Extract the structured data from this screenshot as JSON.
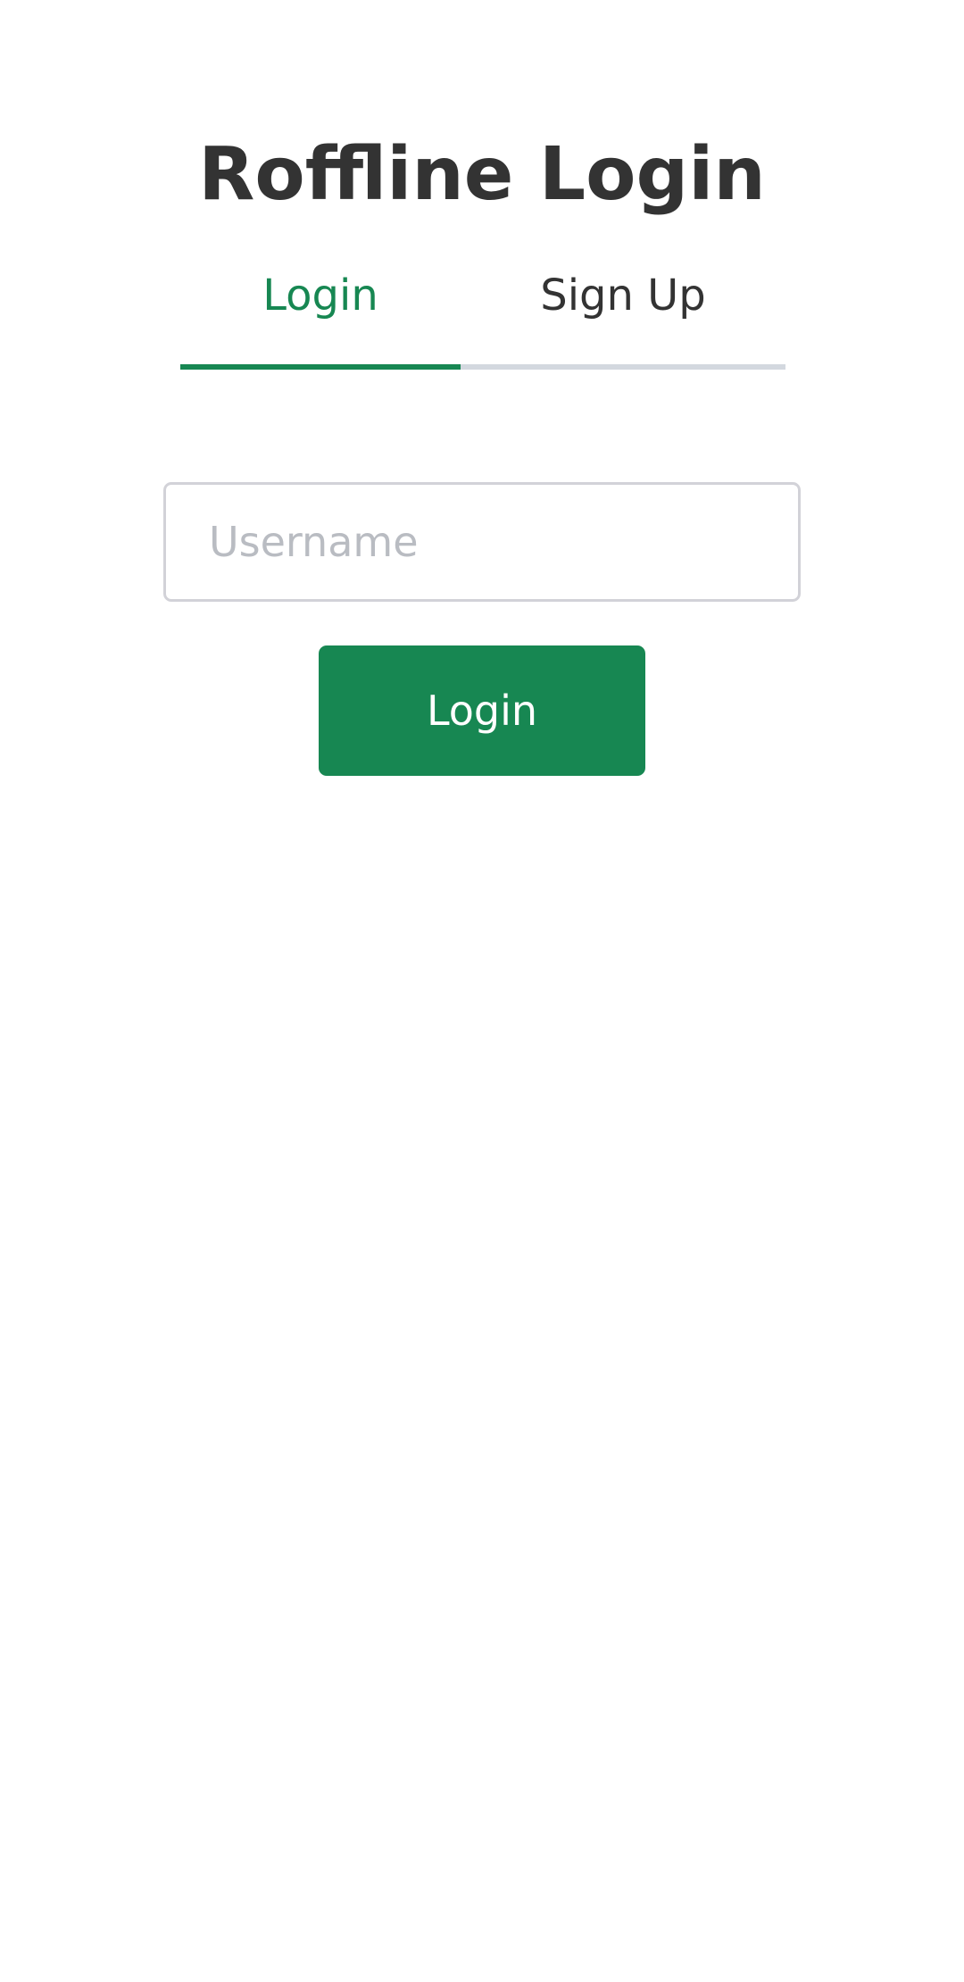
{
  "app": {
    "title": "Roffline Login"
  },
  "tabs": {
    "active": "login",
    "items": [
      {
        "id": "login",
        "label": "Login"
      },
      {
        "id": "signup",
        "label": "Sign Up"
      }
    ]
  },
  "form": {
    "username": {
      "value": "",
      "placeholder": "Username"
    },
    "submit_label": "Login"
  },
  "colors": {
    "accent": "#178752",
    "text": "#333333",
    "tab_inactive_underline": "#d3d8df",
    "input_border": "#d2d2d8",
    "placeholder": "#b9bcc2"
  }
}
